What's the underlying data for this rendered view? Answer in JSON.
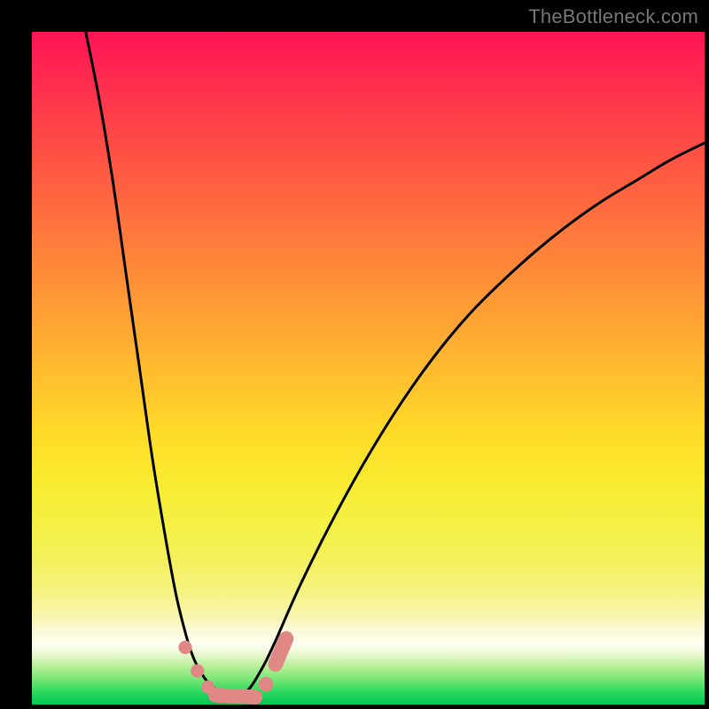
{
  "watermark": "TheBottleneck.com",
  "chart_data": {
    "type": "line",
    "title": "",
    "xlabel": "",
    "ylabel": "",
    "xlim": [
      0,
      100
    ],
    "ylim": [
      0,
      100
    ],
    "grid": false,
    "series": [
      {
        "name": "left-branch",
        "x": [
          8,
          10,
          12,
          14,
          16,
          18,
          20,
          21.5,
          23,
          24,
          25,
          26,
          27,
          28,
          29,
          30
        ],
        "y": [
          100,
          90,
          78,
          64,
          50,
          36,
          24,
          16,
          10,
          7,
          5,
          3.5,
          2.5,
          1.8,
          1.2,
          0.8
        ]
      },
      {
        "name": "right-branch",
        "x": [
          30,
          32,
          34,
          36,
          40,
          45,
          50,
          55,
          60,
          65,
          70,
          75,
          80,
          85,
          90,
          95,
          100
        ],
        "y": [
          0.8,
          2,
          5,
          9,
          18,
          28,
          37,
          45,
          52,
          58,
          63,
          67.5,
          71.5,
          75,
          78,
          81,
          83.5
        ]
      }
    ],
    "markers": [
      {
        "shape": "circle",
        "cx": 22.8,
        "cy": 8.5,
        "r": 1.0
      },
      {
        "shape": "circle",
        "cx": 24.6,
        "cy": 5.0,
        "r": 1.0
      },
      {
        "shape": "circle",
        "cx": 26.2,
        "cy": 2.6,
        "r": 1.0
      },
      {
        "shape": "capsule",
        "x1": 27.3,
        "y1": 1.4,
        "x2": 33.2,
        "y2": 1.1,
        "w": 2.2
      },
      {
        "shape": "circle",
        "cx": 34.8,
        "cy": 3.0,
        "r": 1.1
      },
      {
        "shape": "capsule",
        "x1": 36.2,
        "y1": 6.0,
        "x2": 37.8,
        "y2": 9.8,
        "w": 2.2
      }
    ],
    "colors": {
      "curve": "#000000",
      "marker_fill": "#e08886",
      "gradient_top": "#ff1455",
      "gradient_bottom": "#00c853"
    }
  }
}
